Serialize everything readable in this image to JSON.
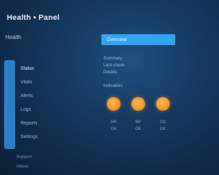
{
  "window": {
    "title": "Health • Panel"
  },
  "left_panel": {
    "header": "Health",
    "nav_items": [
      {
        "label": "Status"
      },
      {
        "label": "Vitals"
      },
      {
        "label": "Alerts"
      },
      {
        "label": "Logs"
      },
      {
        "label": "Reports"
      },
      {
        "label": "Settings"
      }
    ],
    "footer_items": [
      {
        "label": "Support"
      },
      {
        "label": "About"
      }
    ]
  },
  "right_panel": {
    "header_bar_label": "Overview",
    "info_lines": [
      "Summary",
      "Last check",
      "Details"
    ],
    "section_label": "Indicators",
    "cards": [
      {
        "icon": "status-dot-icon",
        "label": "HR",
        "sub": "OK"
      },
      {
        "icon": "status-dot-icon",
        "label": "BP",
        "sub": "OK"
      },
      {
        "icon": "status-dot-icon",
        "label": "O2",
        "sub": "OK"
      }
    ]
  },
  "colors": {
    "background": "#163c63",
    "accent_blue": "#33a3f0",
    "accent_orange": "#f4962a"
  }
}
